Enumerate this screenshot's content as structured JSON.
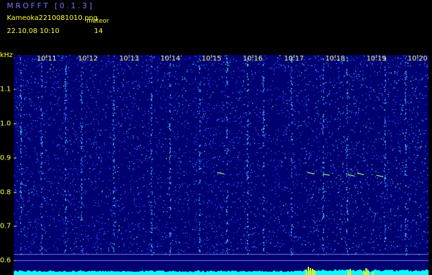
{
  "header": {
    "app_title": "MROFFT [0.1.3]",
    "file_name": "Kameoka2210081010.png",
    "meteor_label": "meteor",
    "datetime": "22.10.08  10:10",
    "meteor_count": "14"
  },
  "axis": {
    "unit": "kHz",
    "time_ticks": [
      "10:11",
      "10:12",
      "10:13",
      "10:14",
      "10:15",
      "10:16",
      "10:17",
      "10:18",
      "10:19",
      "10:20"
    ],
    "freq_ticks": [
      "1.1",
      "1.0",
      "0.9",
      "0.8",
      "0.7",
      "0.6"
    ]
  },
  "colors": {
    "background": "#000000",
    "spectrogram": "#000070",
    "title": "#6f74ff",
    "text": "#ffff33",
    "cyan": "#00ffff",
    "meteor_yellow": "#ffff00"
  }
}
